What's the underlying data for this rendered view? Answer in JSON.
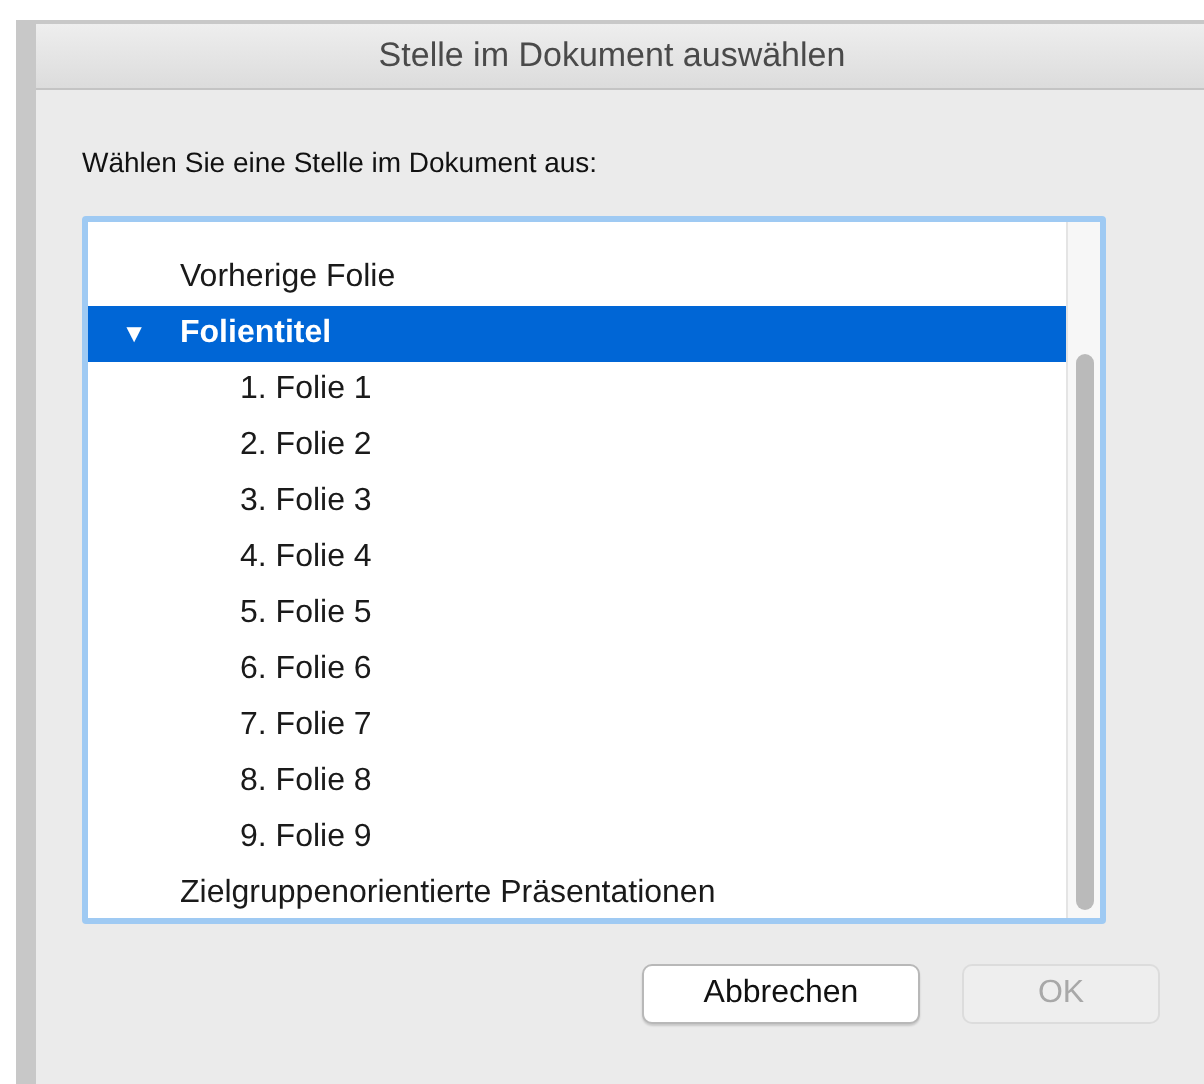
{
  "window": {
    "title": "Stelle im Dokument auswählen"
  },
  "prompt": "Wählen Sie eine Stelle im Dokument aus:",
  "tree": [
    {
      "label": "Vorherige Folie",
      "selected": false
    },
    {
      "label": "Folientitel",
      "selected": true,
      "expanded": true,
      "toggle": "▼",
      "children": [
        {
          "label": "1. Folie 1",
          "selected": false
        },
        {
          "label": "2. Folie 2",
          "selected": false
        },
        {
          "label": "3. Folie 3",
          "selected": false
        },
        {
          "label": "4. Folie 4",
          "selected": false
        },
        {
          "label": "5. Folie 5",
          "selected": false
        },
        {
          "label": "6. Folie 6",
          "selected": false
        },
        {
          "label": "7. Folie 7",
          "selected": false
        },
        {
          "label": "8. Folie 8",
          "selected": false
        },
        {
          "label": "9. Folie 9",
          "selected": false
        }
      ]
    },
    {
      "label": "Zielgruppenorientierte Präsentationen",
      "selected": false
    }
  ],
  "buttons": [
    {
      "label": "Abbrechen",
      "disabled": false
    },
    {
      "label": "OK",
      "disabled": true
    }
  ]
}
